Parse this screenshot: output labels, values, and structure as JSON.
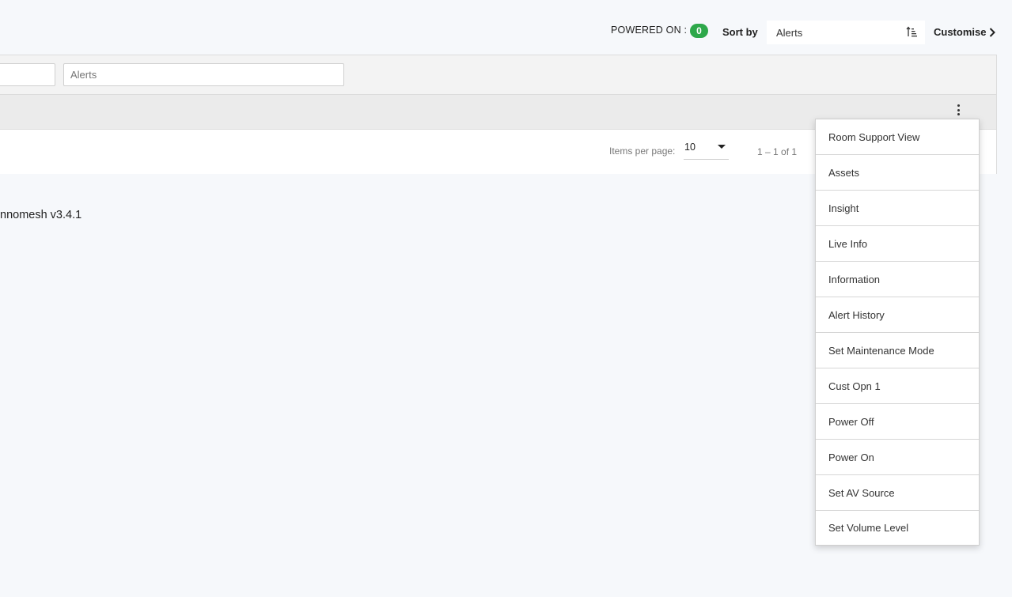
{
  "topbar": {
    "powered_label": "POWERED ON :",
    "powered_count": "0",
    "sort_label": "Sort by",
    "sort_value": "Alerts",
    "sort_icon": "sort-ascending-icon",
    "customise_label": "Customise",
    "customise_icon": "chevron-right-icon",
    "badge_color": "#2ea84a"
  },
  "filters": {
    "alerts_placeholder": "Alerts"
  },
  "table": {
    "kebab_icon": "more-vertical-icon"
  },
  "pager": {
    "items_per_page_label": "Items per page:",
    "items_per_page_value": "10",
    "range_label": "1 – 1 of 1"
  },
  "footer": {
    "version_text": "nnomesh v3.4.1"
  },
  "menu": {
    "items": [
      {
        "label": "Room Support View"
      },
      {
        "label": "Assets"
      },
      {
        "label": "Insight"
      },
      {
        "label": "Live Info"
      },
      {
        "label": "Information"
      },
      {
        "label": "Alert History"
      },
      {
        "label": "Set Maintenance Mode"
      },
      {
        "label": "Cust Opn 1"
      },
      {
        "label": "Power Off"
      },
      {
        "label": "Power On"
      },
      {
        "label": "Set AV Source"
      },
      {
        "label": "Set Volume Level"
      }
    ]
  }
}
